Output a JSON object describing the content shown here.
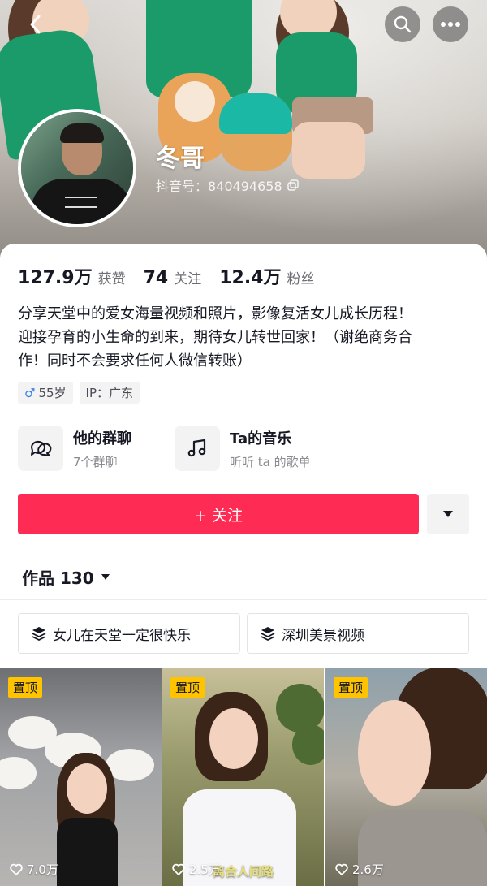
{
  "header": {
    "name": "冬哥",
    "douyin_id": "抖音号：840494658"
  },
  "stats": [
    {
      "value": "127.9万",
      "label": "获赞"
    },
    {
      "value": "74",
      "label": "关注"
    },
    {
      "value": "12.4万",
      "label": "粉丝"
    }
  ],
  "bio": [
    "分享天堂中的爱女海量视频和照片，影像复活女儿成长历程！",
    "迎接孕育的小生命的到来，期待女儿转世回家！（谢绝商务合",
    "作！同时不会要求任何人微信转账）"
  ],
  "tags": {
    "gender_symbol": "♂",
    "age": "55岁",
    "ip": "IP：广东"
  },
  "entries": [
    {
      "title": "他的群聊",
      "subtitle": "7个群聊",
      "icon": "chat-icon"
    },
    {
      "title": "Ta的音乐",
      "subtitle": "听听 ta 的歌单",
      "icon": "music-note-icon"
    }
  ],
  "follow_button": "+ 关注",
  "works_tab": "作品 130",
  "collections": [
    "女儿在天堂一定很快乐",
    "深圳美景视频"
  ],
  "videos": [
    {
      "pinned_label": "置顶",
      "likes": "7.0万",
      "caption": ""
    },
    {
      "pinned_label": "置顶",
      "likes": "2.5万",
      "caption": "离合人间路"
    },
    {
      "pinned_label": "置顶",
      "likes": "2.6万",
      "caption": ""
    }
  ],
  "colors": {
    "accent": "#fe2c55",
    "pin_badge": "#ffc300",
    "male_symbol": "#3b7fe8"
  }
}
